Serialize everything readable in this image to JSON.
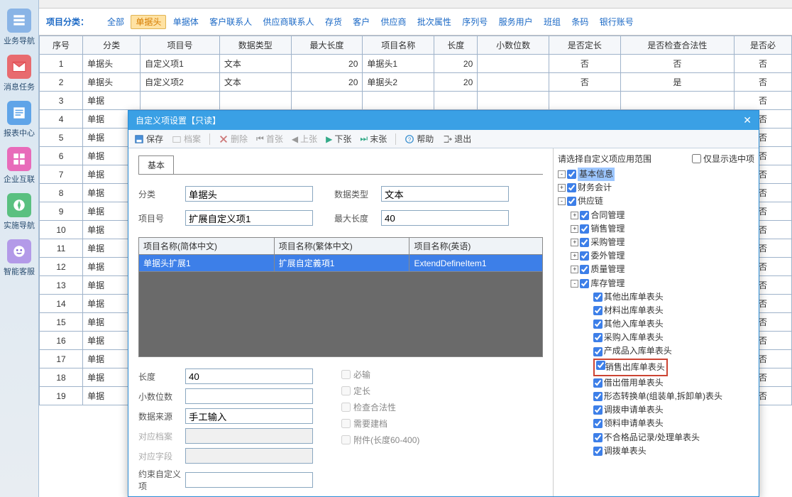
{
  "sidebar": [
    {
      "label": "业务导航",
      "color": "#89b4e6",
      "glyph": "nav"
    },
    {
      "label": "消息任务",
      "color": "#e86b6f",
      "glyph": "mail"
    },
    {
      "label": "报表中心",
      "color": "#5fa4e8",
      "glyph": "report"
    },
    {
      "label": "企业互联",
      "color": "#e86bba",
      "glyph": "grid"
    },
    {
      "label": "实施导航",
      "color": "#5ac080",
      "glyph": "compass"
    },
    {
      "label": "智能客服",
      "color": "#b39ae8",
      "glyph": "face"
    }
  ],
  "filter": {
    "label": "项目分类：",
    "options": [
      "全部",
      "单据头",
      "单据体",
      "客户联系人",
      "供应商联系人",
      "存货",
      "客户",
      "供应商",
      "批次属性",
      "序列号",
      "服务用户",
      "班组",
      "条码",
      "银行账号"
    ],
    "active": "单据头"
  },
  "table": {
    "headers": [
      "序号",
      "分类",
      "项目号",
      "数据类型",
      "最大长度",
      "项目名称",
      "长度",
      "小数位数",
      "是否定长",
      "是否检查合法性",
      "是否必"
    ],
    "rows": [
      {
        "n": 1,
        "cat": "单据头",
        "proj": "自定义项1",
        "dt": "文本",
        "maxlen": "20",
        "name": "单据头1",
        "len": "20",
        "dec": "",
        "fixed": "否",
        "valid": "否",
        "req": "否"
      },
      {
        "n": 2,
        "cat": "单据头",
        "proj": "自定义项2",
        "dt": "文本",
        "maxlen": "20",
        "name": "单据头2",
        "len": "20",
        "dec": "",
        "fixed": "否",
        "valid": "是",
        "req": "否"
      },
      {
        "n": 3,
        "cat": "单据",
        "proj": "",
        "dt": "",
        "maxlen": "",
        "name": "",
        "len": "",
        "dec": "",
        "fixed": "",
        "valid": "",
        "req": "否"
      },
      {
        "n": 4,
        "cat": "单据",
        "proj": "",
        "dt": "",
        "maxlen": "",
        "name": "",
        "len": "",
        "dec": "",
        "fixed": "",
        "valid": "",
        "req": "否"
      },
      {
        "n": 5,
        "cat": "单据",
        "proj": "",
        "dt": "",
        "maxlen": "",
        "name": "",
        "len": "",
        "dec": "",
        "fixed": "",
        "valid": "",
        "req": "否"
      },
      {
        "n": 6,
        "cat": "单据",
        "proj": "",
        "dt": "",
        "maxlen": "",
        "name": "",
        "len": "",
        "dec": "",
        "fixed": "",
        "valid": "",
        "req": "否"
      },
      {
        "n": 7,
        "cat": "单据",
        "proj": "",
        "dt": "",
        "maxlen": "",
        "name": "",
        "len": "",
        "dec": "",
        "fixed": "",
        "valid": "",
        "req": "否"
      },
      {
        "n": 8,
        "cat": "单据",
        "proj": "",
        "dt": "",
        "maxlen": "",
        "name": "",
        "len": "",
        "dec": "",
        "fixed": "",
        "valid": "",
        "req": "否"
      },
      {
        "n": 9,
        "cat": "单据",
        "proj": "",
        "dt": "",
        "maxlen": "",
        "name": "",
        "len": "",
        "dec": "",
        "fixed": "",
        "valid": "",
        "req": "否"
      },
      {
        "n": 10,
        "cat": "单据",
        "proj": "",
        "dt": "",
        "maxlen": "",
        "name": "",
        "len": "",
        "dec": "",
        "fixed": "",
        "valid": "",
        "req": "否"
      },
      {
        "n": 11,
        "cat": "单据",
        "proj": "",
        "dt": "",
        "maxlen": "",
        "name": "",
        "len": "",
        "dec": "",
        "fixed": "",
        "valid": "",
        "req": "否"
      },
      {
        "n": 12,
        "cat": "单据",
        "proj": "",
        "dt": "",
        "maxlen": "",
        "name": "",
        "len": "",
        "dec": "",
        "fixed": "",
        "valid": "",
        "req": "否"
      },
      {
        "n": 13,
        "cat": "单据",
        "proj": "",
        "dt": "",
        "maxlen": "",
        "name": "",
        "len": "",
        "dec": "",
        "fixed": "",
        "valid": "",
        "req": "否"
      },
      {
        "n": 14,
        "cat": "单据",
        "proj": "",
        "dt": "",
        "maxlen": "",
        "name": "",
        "len": "",
        "dec": "",
        "fixed": "",
        "valid": "",
        "req": "否"
      },
      {
        "n": 15,
        "cat": "单据",
        "proj": "",
        "dt": "",
        "maxlen": "",
        "name": "",
        "len": "",
        "dec": "",
        "fixed": "",
        "valid": "",
        "req": "否"
      },
      {
        "n": 16,
        "cat": "单据",
        "proj": "",
        "dt": "",
        "maxlen": "",
        "name": "",
        "len": "",
        "dec": "",
        "fixed": "",
        "valid": "",
        "req": "否"
      },
      {
        "n": 17,
        "cat": "单据",
        "proj": "",
        "dt": "",
        "maxlen": "",
        "name": "",
        "len": "",
        "dec": "",
        "fixed": "",
        "valid": "",
        "req": "否"
      },
      {
        "n": 18,
        "cat": "单据",
        "proj": "",
        "dt": "",
        "maxlen": "",
        "name": "",
        "len": "",
        "dec": "",
        "fixed": "",
        "valid": "",
        "req": "否"
      },
      {
        "n": 19,
        "cat": "单据",
        "proj": "",
        "dt": "",
        "maxlen": "",
        "name": "",
        "len": "",
        "dec": "",
        "fixed": "",
        "valid": "",
        "req": "否"
      }
    ]
  },
  "dialog": {
    "title": "自定义项设置【只读】",
    "toolbar": {
      "save": "保存",
      "archive": "档案",
      "delete": "删除",
      "first": "首张",
      "prev": "上张",
      "next": "下张",
      "last": "末张",
      "help": "帮助",
      "exit": "退出"
    },
    "tab": "基本",
    "form": {
      "cat_label": "分类",
      "cat_value": "单据头",
      "dtype_label": "数据类型",
      "dtype_value": "文本",
      "proj_label": "项目号",
      "proj_value": "扩展自定义项1",
      "maxlen_label": "最大长度",
      "maxlen_value": "40",
      "len_label": "长度",
      "len_value": "40",
      "dec_label": "小数位数",
      "dec_value": "",
      "src_label": "数据来源",
      "src_value": "手工输入",
      "arch_label": "对应档案",
      "arch_value": "",
      "field_label": "对应字段",
      "field_value": "",
      "bind_label": "约束自定义项",
      "bind_value": ""
    },
    "namegrid": {
      "headers": [
        "项目名称(简体中文)",
        "项目名称(繁体中文)",
        "项目名称(英语)"
      ],
      "row": [
        "单据头扩展1",
        "扩展自定義項1",
        "ExtendDefineItem1"
      ]
    },
    "checks": {
      "required": "必输",
      "fixed": "定长",
      "valid": "检查合法性",
      "need_arch": "需要建档",
      "attach": "附件(长度60-400)"
    },
    "right": {
      "title": "请选择自定义项应用范围",
      "onlysel": "仅显示选中项",
      "tree": {
        "basic": "基本信息",
        "finance": "财务会计",
        "supply": "供应链",
        "contract": "合同管理",
        "sales": "销售管理",
        "purchase": "采购管理",
        "outsrc": "委外管理",
        "quality": "质量管理",
        "inv": "库存管理",
        "inv_children": [
          "其他出库单表头",
          "材料出库单表头",
          "其他入库单表头",
          "采购入库单表头",
          "产成品入库单表头",
          "销售出库单表头",
          "借出借用单表头",
          "形态转换单(组装单,拆卸单)表头",
          "调拨申请单表头",
          "领料申请单表头",
          "不合格品记录/处理单表头",
          "调拨单表头"
        ]
      }
    }
  }
}
